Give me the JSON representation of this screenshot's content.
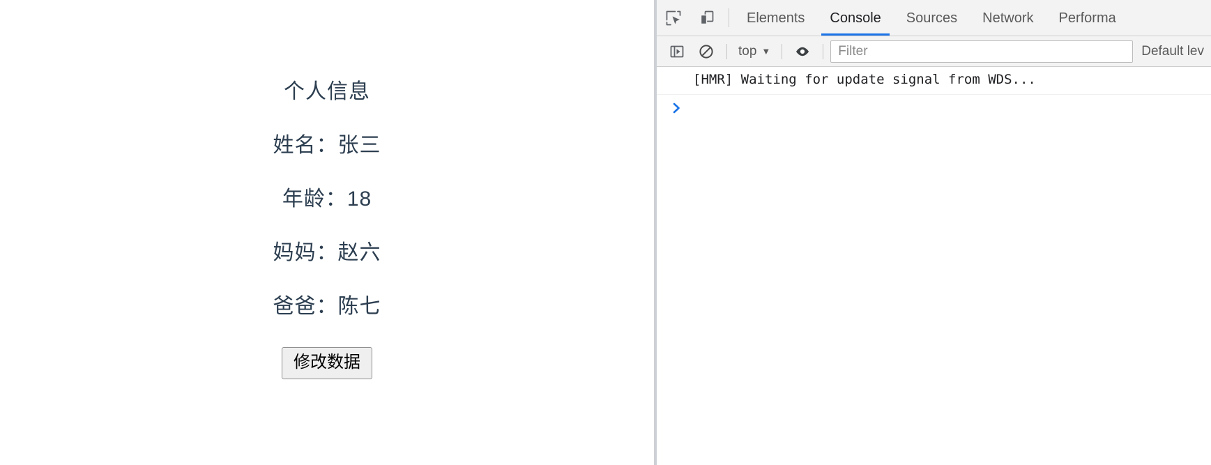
{
  "page": {
    "title": "个人信息",
    "fields": [
      {
        "label": "姓名：",
        "value": "张三"
      },
      {
        "label": "年龄：",
        "value": "18"
      },
      {
        "label": "妈妈：",
        "value": "赵六"
      },
      {
        "label": "爸爸：",
        "value": "陈七"
      }
    ],
    "button_label": "修改数据",
    "text_color": "#2c3e50"
  },
  "devtools": {
    "icons": {
      "inspect": "inspect-element-icon",
      "device": "device-toolbar-icon",
      "sidebar": "console-sidebar-icon",
      "clear": "clear-console-icon",
      "eye": "live-expression-eye-icon"
    },
    "tabs": [
      {
        "label": "Elements",
        "active": false
      },
      {
        "label": "Console",
        "active": true
      },
      {
        "label": "Sources",
        "active": false
      },
      {
        "label": "Network",
        "active": false
      },
      {
        "label": "Performa",
        "active": false
      }
    ],
    "active_tab_color": "#1a73e8",
    "toolbar": {
      "context": "top",
      "context_caret": "▼",
      "filter_placeholder": "Filter",
      "filter_value": "",
      "levels_label": "Default lev"
    },
    "console": {
      "messages": [
        "[HMR] Waiting for update signal from WDS..."
      ],
      "prompt_caret": "❯",
      "prompt_value": ""
    }
  }
}
